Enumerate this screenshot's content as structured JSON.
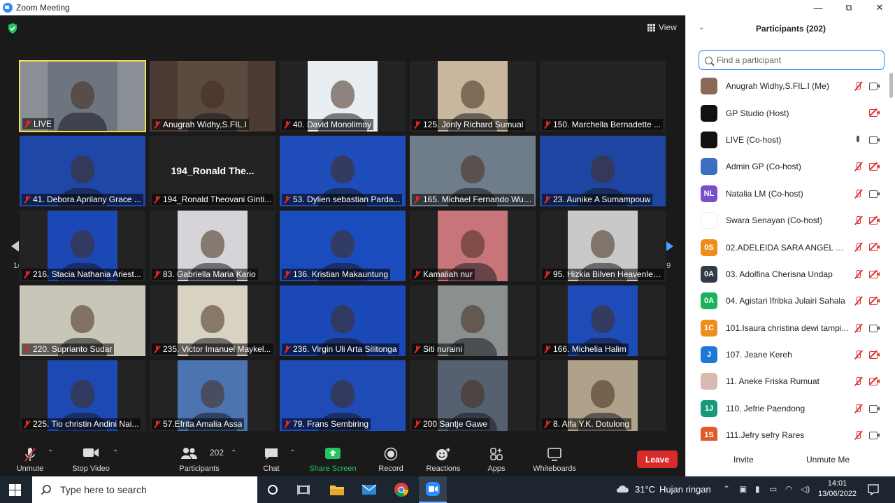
{
  "window": {
    "title": "Zoom Meeting",
    "minimize": "—",
    "restore": "⧉",
    "close": "✕"
  },
  "view_label": "View",
  "pager": {
    "left": "1/9",
    "right": "1/9"
  },
  "tiles": [
    {
      "name": "LIVE",
      "bg": "#8a8f95",
      "vbg": "#6d7680"
    },
    {
      "name": "Anugrah Widhy,S.FIL.I",
      "bg": "#4b3b33",
      "vbg": "#5a4a40"
    },
    {
      "name": "40. David Monolimay",
      "bg": "#232323",
      "vbg": "#e8eef2"
    },
    {
      "name": "125. Jonly Richard Sumual",
      "bg": "#232323",
      "vbg": "#c8b79e"
    },
    {
      "name": "150. Marchella Bernadette ...",
      "bg": "#232323",
      "vbg": "#232323"
    },
    {
      "name": "41. Debora Aprilany Grace ...",
      "bg": "#1f47a8",
      "vbg": "#1f47a8"
    },
    {
      "name": "194_Ronald Theovani Ginti...",
      "bg": "#232323",
      "vbg": "#232323",
      "big": "194_Ronald The..."
    },
    {
      "name": "53. Dylien sebastian Parda...",
      "bg": "#1e4cb8",
      "vbg": "#1e4cb8"
    },
    {
      "name": "165. Michael Fernando Wui...",
      "bg": "#6f7c8a",
      "vbg": "#6f7c8a"
    },
    {
      "name": "23. Aunike A Sumampouw",
      "bg": "#1f45a3",
      "vbg": "#1f45a3"
    },
    {
      "name": "216. Stacia Nathania Ariest...",
      "bg": "#232323",
      "vbg": "#1b48b5"
    },
    {
      "name": "83. Gabriella Maria Kario",
      "bg": "#232323",
      "vbg": "#d6d4d8"
    },
    {
      "name": "136. Kristian Makauntung",
      "bg": "#1b4cbd",
      "vbg": "#1b4cbd"
    },
    {
      "name": "Kamaliah nur",
      "bg": "#232323",
      "vbg": "#c7757b"
    },
    {
      "name": "95. Hizkia Bilven Heavenley...",
      "bg": "#232323",
      "vbg": "#c9c9c9"
    },
    {
      "name": "220. Suprianto Sudar",
      "bg": "#c9c5b9",
      "vbg": "#c9c5b9"
    },
    {
      "name": "235. Victor Imanuel Maykel...",
      "bg": "#232323",
      "vbg": "#d8d2c3"
    },
    {
      "name": "236. Virgin Uli Arta Silitonga",
      "bg": "#1a48b6",
      "vbg": "#1a48b6"
    },
    {
      "name": "Siti nuraini",
      "bg": "#232323",
      "vbg": "#8a8f8f"
    },
    {
      "name": "166. Michelia Halim",
      "bg": "#232323",
      "vbg": "#1d4cb8"
    },
    {
      "name": "225. Tio christin Andini Nai...",
      "bg": "#232323",
      "vbg": "#1c49b2"
    },
    {
      "name": "57.Efrita Amalia Assa",
      "bg": "#232323",
      "vbg": "#4c74b0"
    },
    {
      "name": "79. Frans Sembiring",
      "bg": "#1e4bb5",
      "vbg": "#1e4bb5"
    },
    {
      "name": "200 Santje Gawe",
      "bg": "#232323",
      "vbg": "#556070"
    },
    {
      "name": "8. Alfa Y.K. Dotulong",
      "bg": "#232323",
      "vbg": "#b0a28a"
    }
  ],
  "toolbar": {
    "unmute": "Unmute",
    "stop_video": "Stop Video",
    "participants": "Participants",
    "participants_count": "202",
    "chat": "Chat",
    "share_screen": "Share Screen",
    "record": "Record",
    "reactions": "Reactions",
    "apps": "Apps",
    "whiteboards": "Whiteboards",
    "leave": "Leave"
  },
  "panel": {
    "title": "Participants (202)",
    "search_placeholder": "Find a participant",
    "invite": "Invite",
    "unmute_me": "Unmute Me",
    "participants": [
      {
        "name": "Anugrah Widhy,S.FIL.I (Me)",
        "initials": "",
        "color": "#8a6a55",
        "mic": "muted",
        "cam": "on"
      },
      {
        "name": "GP Studio (Host)",
        "initials": "",
        "color": "#111111",
        "mic": "none",
        "cam": "off"
      },
      {
        "name": "LIVE (Co-host)",
        "initials": "",
        "color": "#111111",
        "mic": "on",
        "cam": "on"
      },
      {
        "name": "Admin GP (Co-host)",
        "initials": "",
        "color": "#3a6fc4",
        "mic": "muted",
        "cam": "off"
      },
      {
        "name": "Natalia LM (Co-host)",
        "initials": "NL",
        "color": "#7b4fc9",
        "mic": "muted",
        "cam": "on"
      },
      {
        "name": "Swara Senayan (Co-host)",
        "initials": "",
        "color": "#ffffff",
        "mic": "muted",
        "cam": "off"
      },
      {
        "name": "02.ADELEIDA SARA ANGEL MA...",
        "initials": "0S",
        "color": "#f08c1a",
        "mic": "muted",
        "cam": "off"
      },
      {
        "name": "03. Adolfina Cherisna Undap",
        "initials": "0A",
        "color": "#2f3b4a",
        "mic": "muted",
        "cam": "off"
      },
      {
        "name": "04. Agistari Ifribka Julairi Sahala",
        "initials": "0A",
        "color": "#19b35a",
        "mic": "muted",
        "cam": "off"
      },
      {
        "name": "101.Isaura christina dewi tampi...",
        "initials": "1C",
        "color": "#f08c1a",
        "mic": "muted",
        "cam": "on"
      },
      {
        "name": "107. Jeane Kereh",
        "initials": "J",
        "color": "#1e78d8",
        "mic": "muted",
        "cam": "off"
      },
      {
        "name": "11. Aneke Friska Rumuat",
        "initials": "",
        "color": "#d9b8b0",
        "mic": "muted",
        "cam": "off"
      },
      {
        "name": "110. Jefrie Paendong",
        "initials": "1J",
        "color": "#169a7a",
        "mic": "muted",
        "cam": "on"
      },
      {
        "name": "111.Jefry sefry Rares",
        "initials": "1S",
        "color": "#e05a2a",
        "mic": "muted",
        "cam": "on"
      }
    ]
  },
  "taskbar": {
    "search_placeholder": "Type here to search",
    "weather_temp": "31°C",
    "weather_desc": "Hujan ringan",
    "time": "14:01",
    "date": "13/06/2022"
  }
}
